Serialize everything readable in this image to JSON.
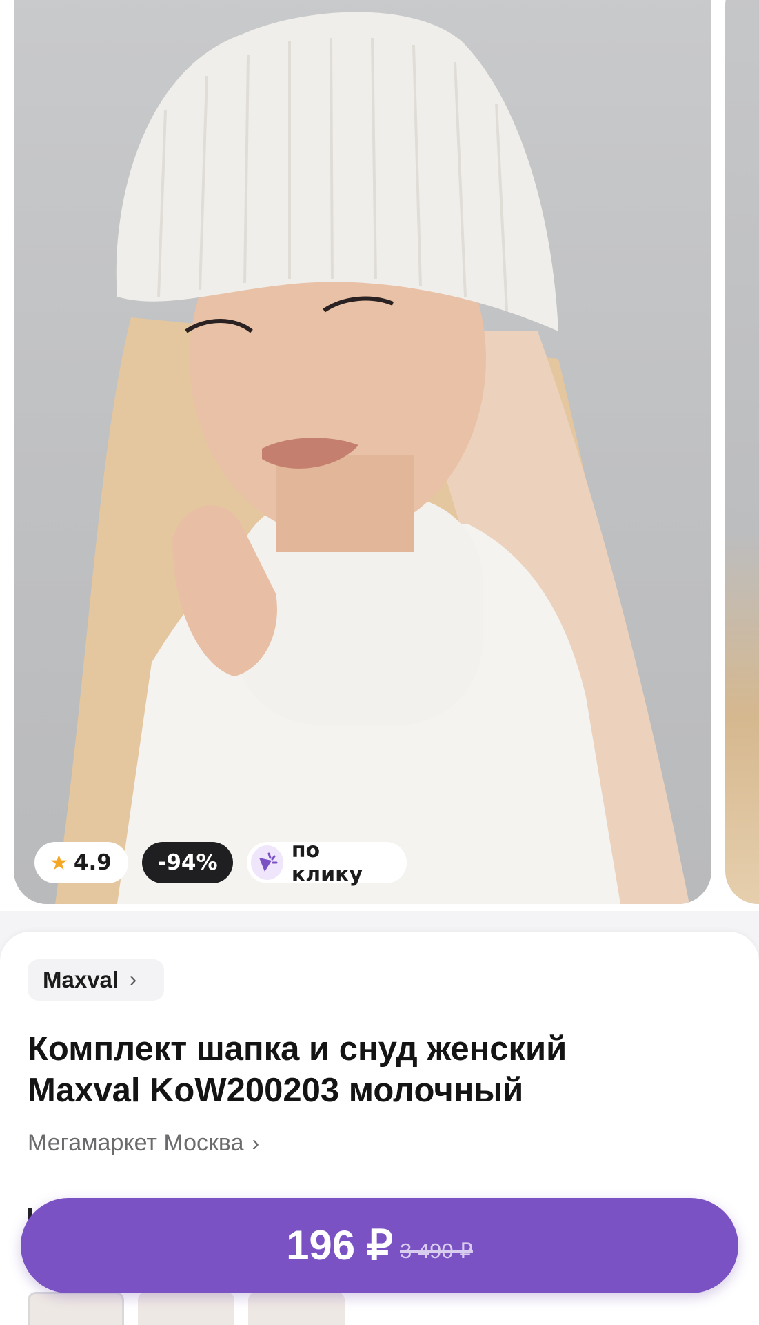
{
  "gallery": {
    "rating_icon": "star-icon",
    "rating": "4.9",
    "discount": "-94%",
    "click_icon": "click-cursor-icon",
    "click_label": "по клику"
  },
  "brand": {
    "name": "Maxval",
    "chevron_icon": "chevron-right-icon"
  },
  "product": {
    "title_line1": "Комплект шапка и снуд женский",
    "title_line2": "Maxval KoW200203 молочный"
  },
  "seller": {
    "name": "Мегамаркет Москва",
    "chevron_icon": "chevron-right-icon"
  },
  "buy": {
    "price": "196 ₽",
    "old_price": "3 490 ₽"
  },
  "colors": {
    "accent": "#7a52c4",
    "rating_star": "#f5a623",
    "discount_badge": "#1f1f21"
  }
}
